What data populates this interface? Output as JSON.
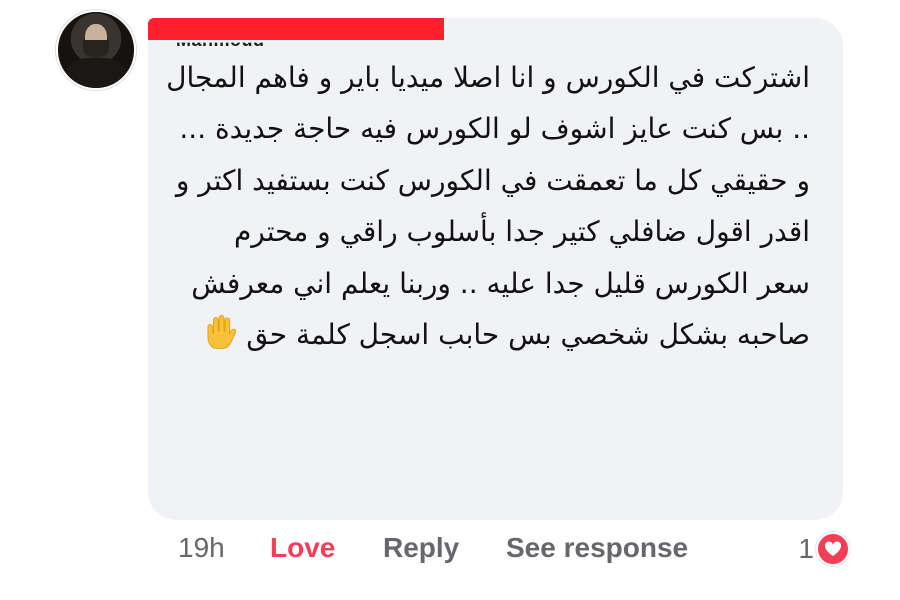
{
  "comment": {
    "author": "Mahmoud",
    "paragraphs": [
      "اشتركت في الكورس و انا اصلا ميديا باير و فاهم المجال .. بس كنت عايز اشوف لو الكورس فيه حاجة جديدة ...",
      "و حقيقي كل ما تعمقت في الكورس كنت بستفيد اكتر و اقدر اقول ضافلي كتير جدا بأسلوب راقي و محترم",
      "سعر الكورس قليل جدا عليه .. وربنا يعلم اني معرفش صاحبه بشكل شخصي بس حابب اسجل كلمة حق"
    ],
    "end_emoji": "raised-hand-icon"
  },
  "actions": {
    "time": "19h",
    "love_label": "Love",
    "reply_label": "Reply",
    "see_response_label": "See response",
    "reaction_count": "1"
  },
  "colors": {
    "bubble": "#f0f2f5",
    "love": "#f33e58",
    "meta_text": "#65676b",
    "redaction": "#ff1f2d"
  }
}
